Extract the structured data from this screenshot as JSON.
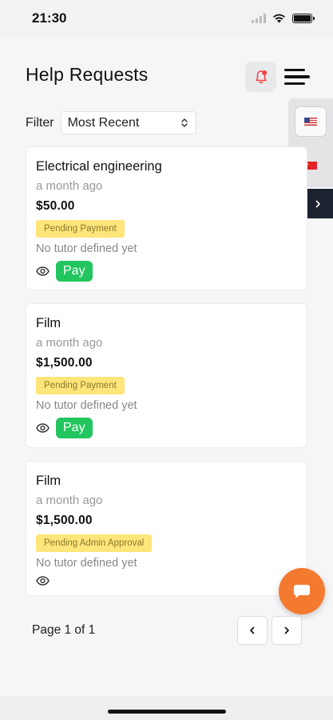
{
  "status_bar": {
    "time": "21:30"
  },
  "header": {
    "title": "Help Requests",
    "icons": {
      "notifications": "bell-icon",
      "menu": "hamburger-menu-icon"
    },
    "accent_color": "#ef4444"
  },
  "language_panel": {
    "languages": [
      {
        "name": "us-flag-icon",
        "selected": true
      },
      {
        "name": "china-flag-icon",
        "selected": false
      }
    ],
    "expand_icon": "chevron-right-icon"
  },
  "filter": {
    "label": "Filter",
    "selected": "Most Recent"
  },
  "requests": [
    {
      "title": "Electrical engineering",
      "time": "a month ago",
      "price": "$50.00",
      "status": "Pending Payment",
      "tutor": "No tutor defined yet",
      "pay_label": "Pay"
    },
    {
      "title": "Film",
      "time": "a month ago",
      "price": "$1,500.00",
      "status": "Pending Payment",
      "tutor": "No tutor defined yet",
      "pay_label": "Pay"
    },
    {
      "title": "Film",
      "time": "a month ago",
      "price": "$1,500.00",
      "status": "Pending Admin Approval",
      "tutor": "No tutor defined yet",
      "pay_label": null
    }
  ],
  "pagination": {
    "text": "Page 1 of 1",
    "prev_icon": "chevron-left-icon",
    "next_icon": "chevron-right-icon"
  },
  "chat": {
    "icon": "chat-bubble-icon",
    "color": "#f47a30"
  },
  "colors": {
    "pay_green": "#22c55e",
    "badge_yellow": "#ffe57a",
    "dark_tab": "#1d2230"
  }
}
